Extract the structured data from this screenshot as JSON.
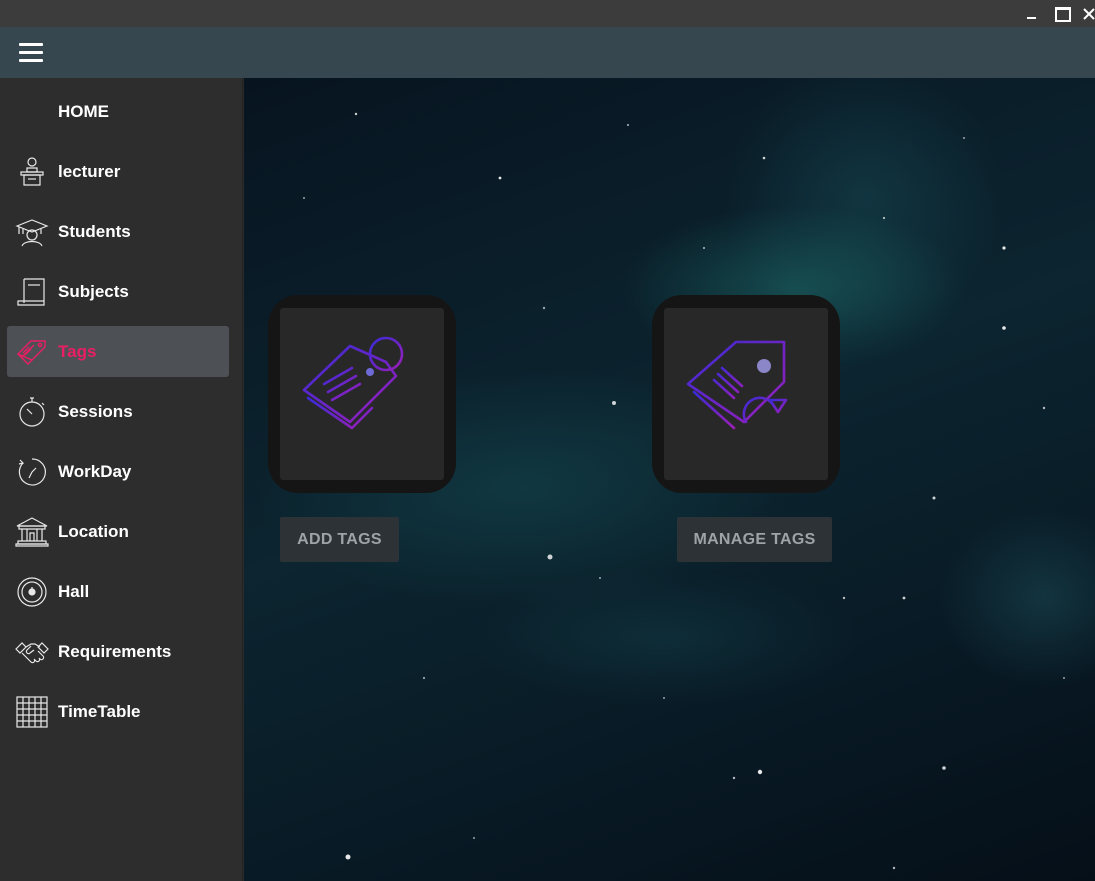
{
  "colors": {
    "accent": "#e91e63",
    "sidebar_bg": "#2d2d2d",
    "appbar_bg": "#37474f",
    "active_item_bg": "#4d5156",
    "icon_gradient_start": "#3a2bd6",
    "icon_gradient_end": "#9b1fb8"
  },
  "sidebar": {
    "items": [
      {
        "label": "HOME",
        "icon": "home"
      },
      {
        "label": "lecturer",
        "icon": "lecturer-podium-icon"
      },
      {
        "label": "Students",
        "icon": "graduate-student-icon"
      },
      {
        "label": "Subjects",
        "icon": "scroll-document-icon"
      },
      {
        "label": "Tags",
        "icon": "tag-icon",
        "active": true
      },
      {
        "label": "Sessions",
        "icon": "stopwatch-icon"
      },
      {
        "label": "WorkDay",
        "icon": "clock-icon"
      },
      {
        "label": "Location",
        "icon": "building-columns-icon"
      },
      {
        "label": "Hall",
        "icon": "target-circle-icon"
      },
      {
        "label": "Requirements",
        "icon": "handshake-icon"
      },
      {
        "label": "TimeTable",
        "icon": "grid-calendar-icon"
      }
    ]
  },
  "main": {
    "add_tags_label": "ADD TAGS",
    "manage_tags_label": "MANAGE TAGS",
    "add_tags_icon": "add-tag-icon",
    "manage_tags_icon": "manage-tag-icon"
  }
}
